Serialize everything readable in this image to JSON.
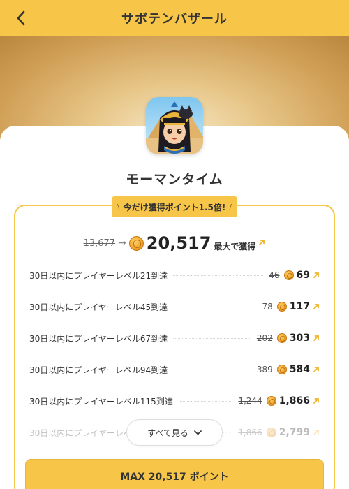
{
  "header": {
    "title": "サボテンバザール"
  },
  "app": {
    "name": "モーマンタイム"
  },
  "promo": {
    "left_mark": "\\",
    "text": "今だけ獲得ポイント1.5倍!",
    "right_mark": "/"
  },
  "summary": {
    "old_points": "13,677",
    "new_points": "20,517",
    "max_label": "最大で獲得"
  },
  "rows": [
    {
      "label": "30日以内にプレイヤーレベル21到達",
      "old": "46",
      "new": "69"
    },
    {
      "label": "30日以内にプレイヤーレベル45到達",
      "old": "78",
      "new": "117"
    },
    {
      "label": "30日以内にプレイヤーレベル67到達",
      "old": "202",
      "new": "303"
    },
    {
      "label": "30日以内にプレイヤーレベル94到達",
      "old": "389",
      "new": "584"
    },
    {
      "label": "30日以内にプレイヤーレベル115到達",
      "old": "1,244",
      "new": "1,866"
    },
    {
      "label": "30日以内にプレイヤーレベ",
      "old": "1,866",
      "new": "2,799"
    }
  ],
  "see_all": {
    "label": "すべて見る"
  },
  "cta": {
    "label": "MAX 20,517 ポイント"
  },
  "colors": {
    "accent": "#F7C548",
    "up_arrow": "#F0B429"
  }
}
